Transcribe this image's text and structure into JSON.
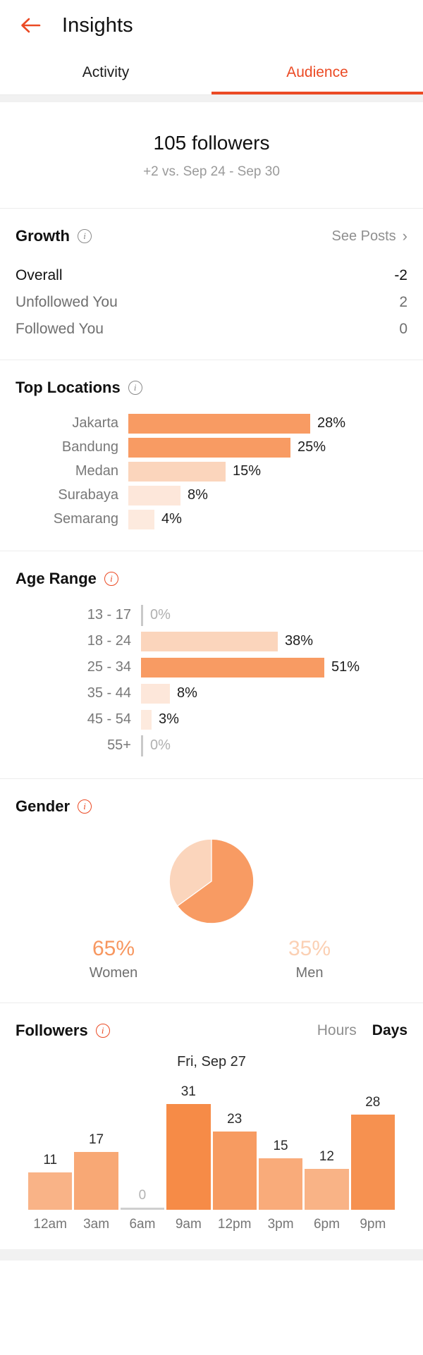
{
  "header": {
    "back_icon": "arrow-left-icon",
    "title": "Insights",
    "accent_color": "#eb4a24"
  },
  "tabs": [
    {
      "label": "Activity",
      "active": false
    },
    {
      "label": "Audience",
      "active": true
    }
  ],
  "summary": {
    "count": "105 followers",
    "comparison": "+2 vs. Sep 24 - Sep 30"
  },
  "growth": {
    "title": "Growth",
    "info_icon": "info-icon",
    "see_posts_label": "See Posts",
    "chevron_icon": "chevron-right-icon",
    "rows": [
      {
        "label": "Overall",
        "value": "-2",
        "primary": true
      },
      {
        "label": "Unfollowed You",
        "value": "2",
        "primary": false
      },
      {
        "label": "Followed You",
        "value": "0",
        "primary": false
      }
    ]
  },
  "top_locations": {
    "title": "Top Locations",
    "info_icon": "info-icon"
  },
  "age_range": {
    "title": "Age Range",
    "info_icon": "info-icon"
  },
  "gender": {
    "title": "Gender",
    "info_icon": "info-icon",
    "women_pct": "65%",
    "women_label": "Women",
    "men_pct": "35%",
    "men_label": "Men"
  },
  "followers": {
    "title": "Followers",
    "info_icon": "info-icon",
    "toggle": [
      {
        "label": "Hours",
        "active": false
      },
      {
        "label": "Days",
        "active": true
      }
    ],
    "day_label": "Fri, Sep 27"
  },
  "chart_data": [
    {
      "type": "bar",
      "orientation": "horizontal",
      "title": "Top Locations",
      "categories": [
        "Jakarta",
        "Bandung",
        "Medan",
        "Surabaya",
        "Semarang"
      ],
      "values": [
        28,
        25,
        15,
        8,
        4
      ],
      "value_labels": [
        "28%",
        "25%",
        "15%",
        "8%",
        "4%"
      ],
      "unit": "%",
      "colors": [
        "#f89b63",
        "#f89b63",
        "#fbd5bc",
        "#fde7da",
        "#fdeade"
      ],
      "xlabel": "",
      "ylabel": "",
      "xlim": [
        0,
        28
      ],
      "grid": false,
      "legend": false
    },
    {
      "type": "bar",
      "orientation": "horizontal",
      "title": "Age Range",
      "categories": [
        "13 - 17",
        "18 - 24",
        "25 - 34",
        "35 - 44",
        "45 - 54",
        "55+"
      ],
      "values": [
        0,
        38,
        51,
        8,
        3,
        0
      ],
      "value_labels": [
        "0%",
        "38%",
        "51%",
        "8%",
        "3%",
        "0%"
      ],
      "unit": "%",
      "colors": [
        "#c9c9c9",
        "#fbd5bc",
        "#f89b63",
        "#fde7da",
        "#fdeade",
        "#c9c9c9"
      ],
      "xlabel": "",
      "ylabel": "",
      "xlim": [
        0,
        51
      ],
      "grid": false,
      "legend": false
    },
    {
      "type": "pie",
      "title": "Gender",
      "categories": [
        "Women",
        "Men"
      ],
      "values": [
        65,
        35
      ],
      "value_labels": [
        "65%",
        "35%"
      ],
      "colors": [
        "#f89b63",
        "#fbd5bc"
      ],
      "legend": "below"
    },
    {
      "type": "bar",
      "orientation": "vertical",
      "title": "Followers",
      "subtitle": "Fri, Sep 27",
      "categories": [
        "12am",
        "3am",
        "6am",
        "9am",
        "12pm",
        "3pm",
        "6pm",
        "9pm"
      ],
      "values": [
        11,
        17,
        0,
        31,
        23,
        15,
        12,
        28
      ],
      "value_labels": [
        "11",
        "17",
        "0",
        "31",
        "23",
        "15",
        "12",
        "28"
      ],
      "xlabel": "",
      "ylabel": "",
      "ylim": [
        0,
        31
      ],
      "grid": false,
      "legend": false
    }
  ]
}
